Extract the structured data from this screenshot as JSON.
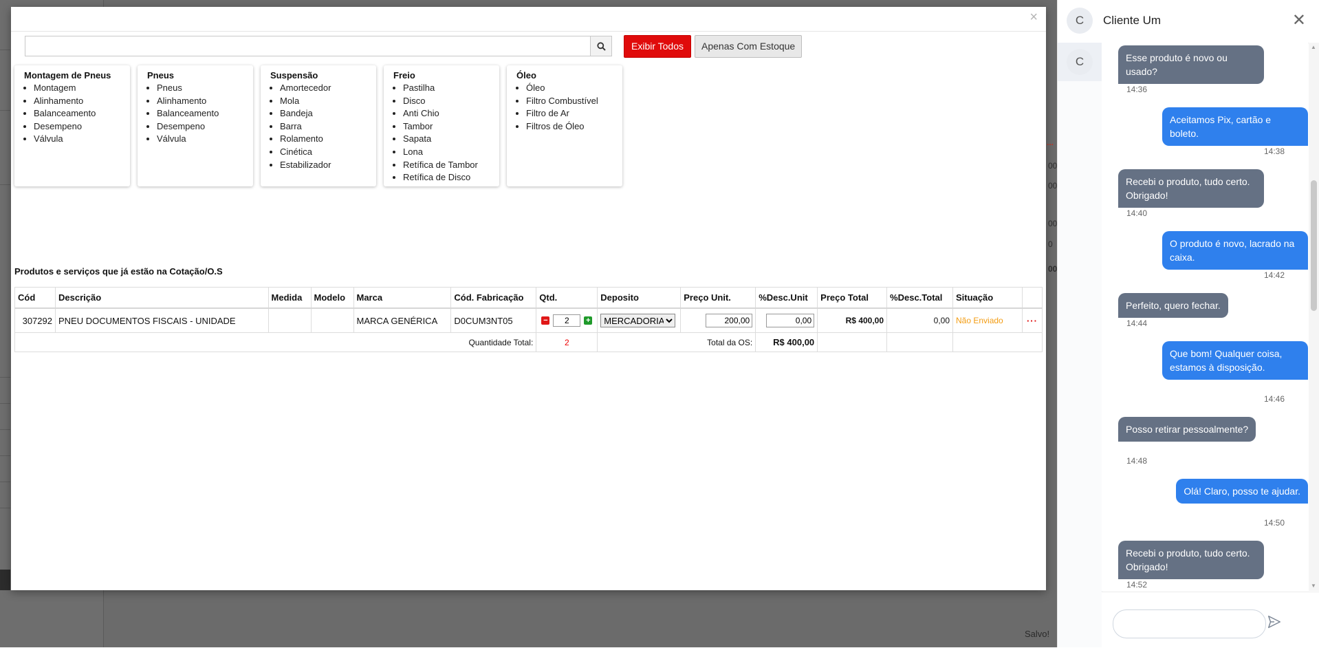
{
  "background": {
    "saved_label": "Salvo!",
    "fragments": [
      "...",
      "00",
      "00",
      "00",
      "0",
      "00"
    ]
  },
  "modal": {
    "close_label": "×",
    "search": {
      "placeholder": "",
      "value": ""
    },
    "buttons": {
      "show_all": "Exibir Todos",
      "only_stock": "Apenas Com Estoque"
    },
    "categories": [
      {
        "title": "Montagem de Pneus",
        "items": [
          "Montagem",
          "Alinhamento",
          "Balanceamento",
          "Desempeno",
          "Válvula"
        ]
      },
      {
        "title": "Pneus",
        "items": [
          "Pneus",
          "Alinhamento",
          "Balanceamento",
          "Desempeno",
          "Válvula"
        ]
      },
      {
        "title": "Suspensão",
        "items": [
          "Amortecedor",
          "Mola",
          "Bandeja",
          "Barra",
          "Rolamento",
          "Cinética",
          "Estabilizador"
        ]
      },
      {
        "title": "Freio",
        "items": [
          "Pastilha",
          "Disco",
          "Anti Chio",
          "Tambor",
          "Sapata",
          "Lona",
          "Retífica de Tambor",
          "Retífica de Disco"
        ]
      },
      {
        "title": "Óleo",
        "items": [
          "Óleo",
          "Filtro Combustível",
          "Filtro de Ar",
          "Filtros de Óleo"
        ]
      }
    ],
    "section_title": "Produtos e serviços que já estão na Cotação/O.S",
    "table": {
      "headers": {
        "cod": "Cód",
        "descricao": "Descrição",
        "medida": "Medida",
        "modelo": "Modelo",
        "marca": "Marca",
        "cod_fabricacao": "Cód. Fabricação",
        "qtd": "Qtd.",
        "deposito": "Deposito",
        "preco_unit": "Preço Unit.",
        "desc_unit": "%Desc.Unit",
        "preco_total": "Preço Total",
        "desc_total": "%Desc.Total",
        "situacao": "Situação"
      },
      "row": {
        "cod": "307292",
        "descricao": "PNEU DOCUMENTOS FISCAIS - UNIDADE",
        "medida": "",
        "modelo": "",
        "marca": "MARCA GENÉRICA",
        "cod_fabricacao": "D0CUM3NT05",
        "qtd": "2",
        "deposito": "MERCADORIA",
        "preco_unit": "200,00",
        "desc_unit": "0,00",
        "preco_total": "R$ 400,00",
        "desc_total": "0,00",
        "situacao": "Não Enviado",
        "more": "···"
      },
      "total_row": {
        "qty_label": "Quantidade Total:",
        "qty_value": "2",
        "os_label": "Total da OS:",
        "os_value": "R$ 400,00"
      }
    }
  },
  "chat": {
    "contact_initial": "C",
    "contact_name": "Cliente Um",
    "close_label": "✕",
    "input_placeholder": "",
    "messages": [
      {
        "dir": "in",
        "text": "Esse produto é novo ou usado?",
        "time": "14:36"
      },
      {
        "dir": "out",
        "text": "Aceitamos Pix, cartão e boleto.",
        "time": "14:38"
      },
      {
        "dir": "in",
        "text": "Recebi o produto, tudo certo. Obrigado!",
        "time": "14:40"
      },
      {
        "dir": "out",
        "text": "O produto é novo, lacrado na caixa.",
        "time": "14:42"
      },
      {
        "dir": "in",
        "text": "Perfeito, quero fechar.",
        "time": "14:44"
      },
      {
        "dir": "out",
        "text": "Que bom! Qualquer coisa, estamos à disposição.",
        "time": "14:46"
      },
      {
        "dir": "in",
        "text": "Posso retirar pessoalmente?",
        "time": "14:48"
      },
      {
        "dir": "out",
        "text": "Olá! Claro, posso te ajudar.",
        "time": "14:50"
      },
      {
        "dir": "in",
        "text": "Recebi o produto, tudo certo. Obrigado!",
        "time": "14:52"
      }
    ]
  },
  "colors": {
    "accent_red": "#e00b0b",
    "status_orange": "#f39c12",
    "bubble_in": "#657184",
    "bubble_out": "#2f80ed",
    "overlay": "#6b6b6b"
  }
}
